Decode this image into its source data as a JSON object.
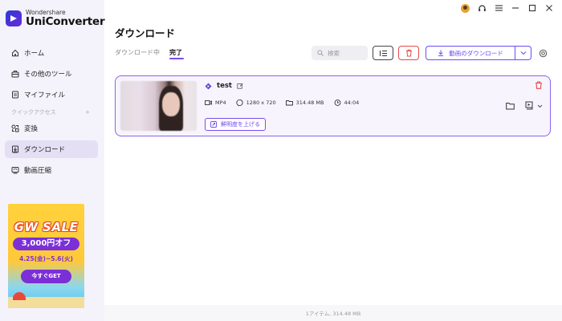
{
  "app": {
    "brand_small": "Wondershare",
    "brand_name": "UniConverter"
  },
  "sidebar": {
    "items": [
      {
        "label": "ホーム",
        "icon": "home-icon"
      },
      {
        "label": "その他のツール",
        "icon": "toolbox-icon"
      },
      {
        "label": "マイファイル",
        "icon": "file-icon"
      }
    ],
    "section_label": "クイックアクセス",
    "section_add": "+",
    "quick_items": [
      {
        "label": "変換",
        "icon": "convert-icon"
      },
      {
        "label": "ダウンロード",
        "icon": "download-icon",
        "active": true
      },
      {
        "label": "動画圧縮",
        "icon": "compress-icon"
      }
    ]
  },
  "promo": {
    "title": "GW SALE",
    "price": "3,000円オフ",
    "date": "4.25(金)~5.6(火)",
    "cta": "今すぐGET"
  },
  "header": {
    "title": "ダウンロード"
  },
  "tabs": [
    {
      "label": "ダウンロード中",
      "active": false
    },
    {
      "label": "完了",
      "active": true
    }
  ],
  "toolbar": {
    "search_placeholder": "検索",
    "download_label": "動画のダウンロード"
  },
  "items": [
    {
      "title": "test",
      "format": "MP4",
      "resolution": "1280 x 720",
      "size": "314.48 MB",
      "duration": "44:04",
      "enhance_label": "鮮明度を上げる"
    }
  ],
  "footer": {
    "summary": "1アイテム, 314.48 MB"
  },
  "colors": {
    "accent": "#7a4cf0",
    "danger": "#e84a4a",
    "sidebar_bg": "#f4f2fa",
    "active_item_bg": "#e4dff4"
  }
}
